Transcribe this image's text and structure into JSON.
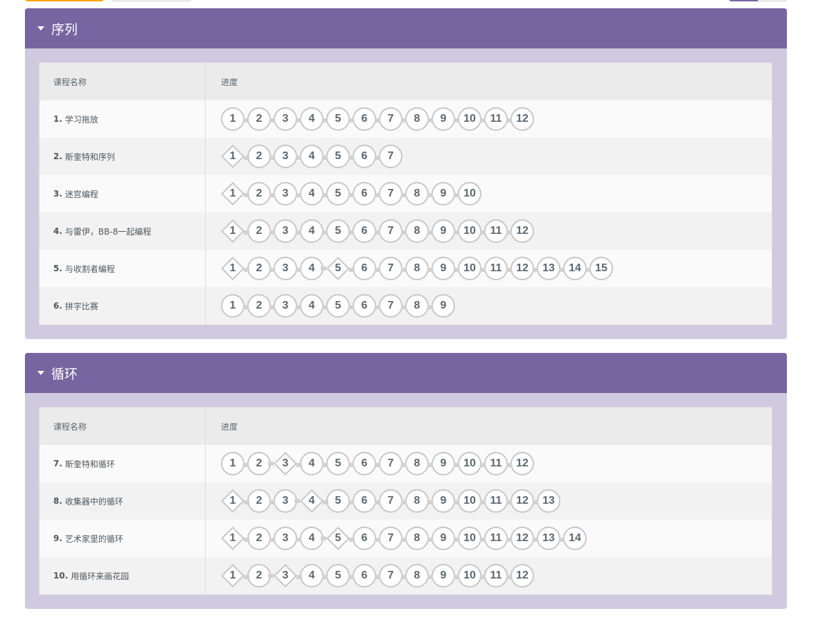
{
  "sections": [
    {
      "title": "序列",
      "header": {
        "name": "课程名称",
        "progress": "进度"
      },
      "lessons": [
        {
          "num": "1.",
          "name": "学习拖放",
          "levels": [
            {
              "n": "1",
              "shape": "circle"
            },
            {
              "n": "2",
              "shape": "circle"
            },
            {
              "n": "3",
              "shape": "circle"
            },
            {
              "n": "4",
              "shape": "circle"
            },
            {
              "n": "5",
              "shape": "circle"
            },
            {
              "n": "6",
              "shape": "circle"
            },
            {
              "n": "7",
              "shape": "circle"
            },
            {
              "n": "8",
              "shape": "circle"
            },
            {
              "n": "9",
              "shape": "circle"
            },
            {
              "n": "10",
              "shape": "circle"
            },
            {
              "n": "11",
              "shape": "circle"
            },
            {
              "n": "12",
              "shape": "circle"
            }
          ]
        },
        {
          "num": "2.",
          "name": "斯奎特和序列",
          "levels": [
            {
              "n": "1",
              "shape": "diamond"
            },
            {
              "n": "2",
              "shape": "circle"
            },
            {
              "n": "3",
              "shape": "circle"
            },
            {
              "n": "4",
              "shape": "circle"
            },
            {
              "n": "5",
              "shape": "circle"
            },
            {
              "n": "6",
              "shape": "circle"
            },
            {
              "n": "7",
              "shape": "circle"
            }
          ]
        },
        {
          "num": "3.",
          "name": "迷宫编程",
          "levels": [
            {
              "n": "1",
              "shape": "diamond"
            },
            {
              "n": "2",
              "shape": "circle"
            },
            {
              "n": "3",
              "shape": "circle"
            },
            {
              "n": "4",
              "shape": "circle"
            },
            {
              "n": "5",
              "shape": "circle"
            },
            {
              "n": "6",
              "shape": "circle"
            },
            {
              "n": "7",
              "shape": "circle"
            },
            {
              "n": "8",
              "shape": "circle"
            },
            {
              "n": "9",
              "shape": "circle"
            },
            {
              "n": "10",
              "shape": "circle"
            }
          ]
        },
        {
          "num": "4.",
          "name": "与雷伊，BB-8一起编程",
          "levels": [
            {
              "n": "1",
              "shape": "diamond"
            },
            {
              "n": "2",
              "shape": "circle"
            },
            {
              "n": "3",
              "shape": "circle"
            },
            {
              "n": "4",
              "shape": "circle"
            },
            {
              "n": "5",
              "shape": "circle"
            },
            {
              "n": "6",
              "shape": "circle"
            },
            {
              "n": "7",
              "shape": "circle"
            },
            {
              "n": "8",
              "shape": "circle"
            },
            {
              "n": "9",
              "shape": "circle"
            },
            {
              "n": "10",
              "shape": "circle"
            },
            {
              "n": "11",
              "shape": "circle"
            },
            {
              "n": "12",
              "shape": "circle"
            }
          ]
        },
        {
          "num": "5.",
          "name": "与收割者编程",
          "levels": [
            {
              "n": "1",
              "shape": "diamond"
            },
            {
              "n": "2",
              "shape": "circle"
            },
            {
              "n": "3",
              "shape": "circle"
            },
            {
              "n": "4",
              "shape": "circle"
            },
            {
              "n": "5",
              "shape": "diamond"
            },
            {
              "n": "6",
              "shape": "circle"
            },
            {
              "n": "7",
              "shape": "circle"
            },
            {
              "n": "8",
              "shape": "circle"
            },
            {
              "n": "9",
              "shape": "circle"
            },
            {
              "n": "10",
              "shape": "circle"
            },
            {
              "n": "11",
              "shape": "circle"
            },
            {
              "n": "12",
              "shape": "circle"
            },
            {
              "n": "13",
              "shape": "circle"
            },
            {
              "n": "14",
              "shape": "circle"
            },
            {
              "n": "15",
              "shape": "circle"
            }
          ]
        },
        {
          "num": "6.",
          "name": "拼字比赛",
          "levels": [
            {
              "n": "1",
              "shape": "circle"
            },
            {
              "n": "2",
              "shape": "circle"
            },
            {
              "n": "3",
              "shape": "circle"
            },
            {
              "n": "4",
              "shape": "circle"
            },
            {
              "n": "5",
              "shape": "circle"
            },
            {
              "n": "6",
              "shape": "circle"
            },
            {
              "n": "7",
              "shape": "circle"
            },
            {
              "n": "8",
              "shape": "circle"
            },
            {
              "n": "9",
              "shape": "circle"
            }
          ]
        }
      ]
    },
    {
      "title": "循环",
      "header": {
        "name": "课程名称",
        "progress": "进度"
      },
      "lessons": [
        {
          "num": "7.",
          "name": "斯奎特和循环",
          "levels": [
            {
              "n": "1",
              "shape": "circle"
            },
            {
              "n": "2",
              "shape": "circle"
            },
            {
              "n": "3",
              "shape": "diamond"
            },
            {
              "n": "4",
              "shape": "circle"
            },
            {
              "n": "5",
              "shape": "circle"
            },
            {
              "n": "6",
              "shape": "circle"
            },
            {
              "n": "7",
              "shape": "circle"
            },
            {
              "n": "8",
              "shape": "circle"
            },
            {
              "n": "9",
              "shape": "circle"
            },
            {
              "n": "10",
              "shape": "circle"
            },
            {
              "n": "11",
              "shape": "circle"
            },
            {
              "n": "12",
              "shape": "circle"
            }
          ]
        },
        {
          "num": "8.",
          "name": "收集器中的循环",
          "levels": [
            {
              "n": "1",
              "shape": "diamond"
            },
            {
              "n": "2",
              "shape": "circle"
            },
            {
              "n": "3",
              "shape": "circle"
            },
            {
              "n": "4",
              "shape": "diamond"
            },
            {
              "n": "5",
              "shape": "circle"
            },
            {
              "n": "6",
              "shape": "circle"
            },
            {
              "n": "7",
              "shape": "circle"
            },
            {
              "n": "8",
              "shape": "circle"
            },
            {
              "n": "9",
              "shape": "circle"
            },
            {
              "n": "10",
              "shape": "circle"
            },
            {
              "n": "11",
              "shape": "circle"
            },
            {
              "n": "12",
              "shape": "circle"
            },
            {
              "n": "13",
              "shape": "circle"
            }
          ]
        },
        {
          "num": "9.",
          "name": "艺术家里的循环",
          "levels": [
            {
              "n": "1",
              "shape": "diamond"
            },
            {
              "n": "2",
              "shape": "circle"
            },
            {
              "n": "3",
              "shape": "circle"
            },
            {
              "n": "4",
              "shape": "circle"
            },
            {
              "n": "5",
              "shape": "diamond"
            },
            {
              "n": "6",
              "shape": "circle"
            },
            {
              "n": "7",
              "shape": "circle"
            },
            {
              "n": "8",
              "shape": "circle"
            },
            {
              "n": "9",
              "shape": "circle"
            },
            {
              "n": "10",
              "shape": "circle"
            },
            {
              "n": "11",
              "shape": "circle"
            },
            {
              "n": "12",
              "shape": "circle"
            },
            {
              "n": "13",
              "shape": "circle"
            },
            {
              "n": "14",
              "shape": "circle"
            }
          ]
        },
        {
          "num": "10.",
          "name": "用循环来画花园",
          "levels": [
            {
              "n": "1",
              "shape": "diamond"
            },
            {
              "n": "2",
              "shape": "circle"
            },
            {
              "n": "3",
              "shape": "diamond"
            },
            {
              "n": "4",
              "shape": "circle"
            },
            {
              "n": "5",
              "shape": "circle"
            },
            {
              "n": "6",
              "shape": "circle"
            },
            {
              "n": "7",
              "shape": "circle"
            },
            {
              "n": "8",
              "shape": "circle"
            },
            {
              "n": "9",
              "shape": "circle"
            },
            {
              "n": "10",
              "shape": "circle"
            },
            {
              "n": "11",
              "shape": "circle"
            },
            {
              "n": "12",
              "shape": "circle"
            }
          ]
        }
      ]
    }
  ]
}
